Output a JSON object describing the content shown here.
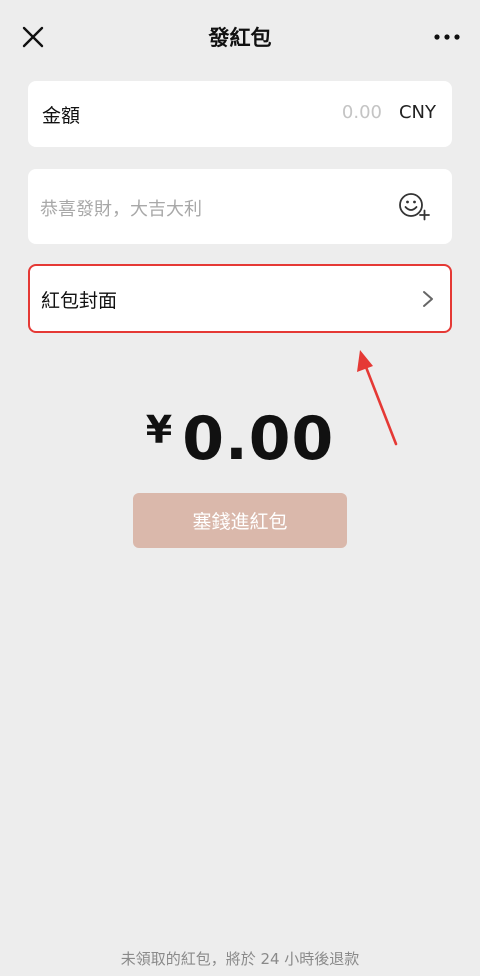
{
  "header": {
    "title": "發紅包",
    "close_icon": "close-icon",
    "more_icon": "more-icon"
  },
  "amount_card": {
    "label": "金額",
    "placeholder": "0.00",
    "currency": "CNY"
  },
  "greeting_card": {
    "placeholder": "恭喜發財，大吉大利",
    "emoji_icon": "emoji-plus-icon"
  },
  "cover_card": {
    "label": "紅包封面",
    "chevron_icon": "chevron-right-icon",
    "highlight_color": "#e53935"
  },
  "annotation": {
    "icon": "red-arrow-annotation",
    "color": "#e53935"
  },
  "total": {
    "symbol": "¥",
    "value": "0.00"
  },
  "submit_button": {
    "label": "塞錢進紅包",
    "background": "#dab8ab"
  },
  "footer": {
    "note": "未領取的紅包，將於 24 小時後退款"
  }
}
